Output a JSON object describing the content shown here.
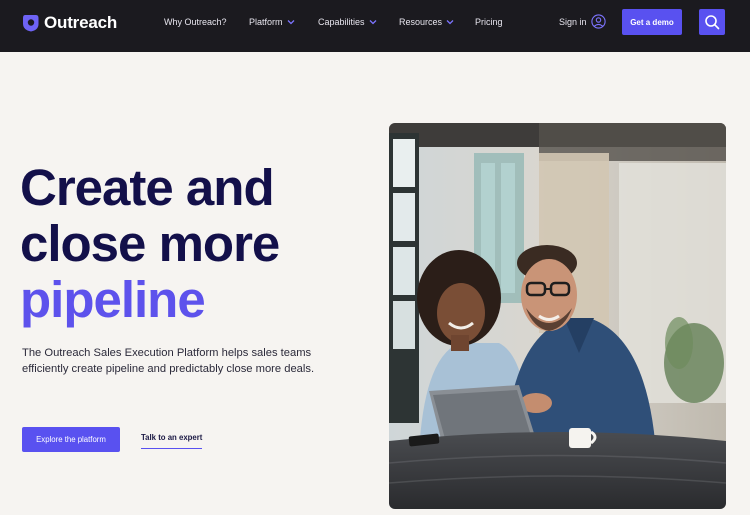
{
  "nav": {
    "logo_text": "Outreach",
    "links": [
      {
        "label": "Why Outreach?"
      },
      {
        "label": "Platform"
      },
      {
        "label": "Capabilities"
      },
      {
        "label": "Resources"
      },
      {
        "label": "Pricing"
      }
    ],
    "signin_label": "Sign in",
    "demo_label": "Get a demo"
  },
  "hero": {
    "title_line1": "Create and",
    "title_line2": "close more",
    "title_accent": "pipeline",
    "subtitle": "The Outreach Sales Execution Platform helps sales teams efficiently create pipeline and predictably close more deals.",
    "primary_cta": "Explore the platform",
    "secondary_cta": "Talk to an expert"
  },
  "colors": {
    "nav_bg": "#1b1a1f",
    "accent": "#5951f0",
    "title_color": "#13104a",
    "page_bg": "#f6f4f1"
  },
  "icons": {
    "logo": "outreach-logo-icon",
    "chevron": "chevron-down-icon",
    "user": "user-circle-icon",
    "search": "search-icon"
  }
}
